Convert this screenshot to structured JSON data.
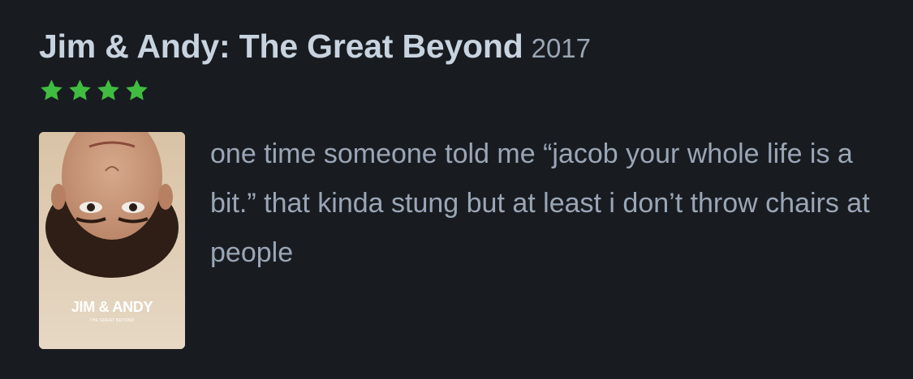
{
  "film": {
    "title": "Jim & Andy: The Great Beyond",
    "year": "2017"
  },
  "rating": {
    "stars": 4,
    "color": "#40bc40",
    "icon": "star-icon"
  },
  "poster": {
    "title": "JIM & ANDY",
    "subtitle": "THE GREAT BEYOND"
  },
  "review": {
    "text": "one time someone told me “jacob your whole life is a bit.” that kinda stung but at least i don’t throw chairs at people"
  }
}
